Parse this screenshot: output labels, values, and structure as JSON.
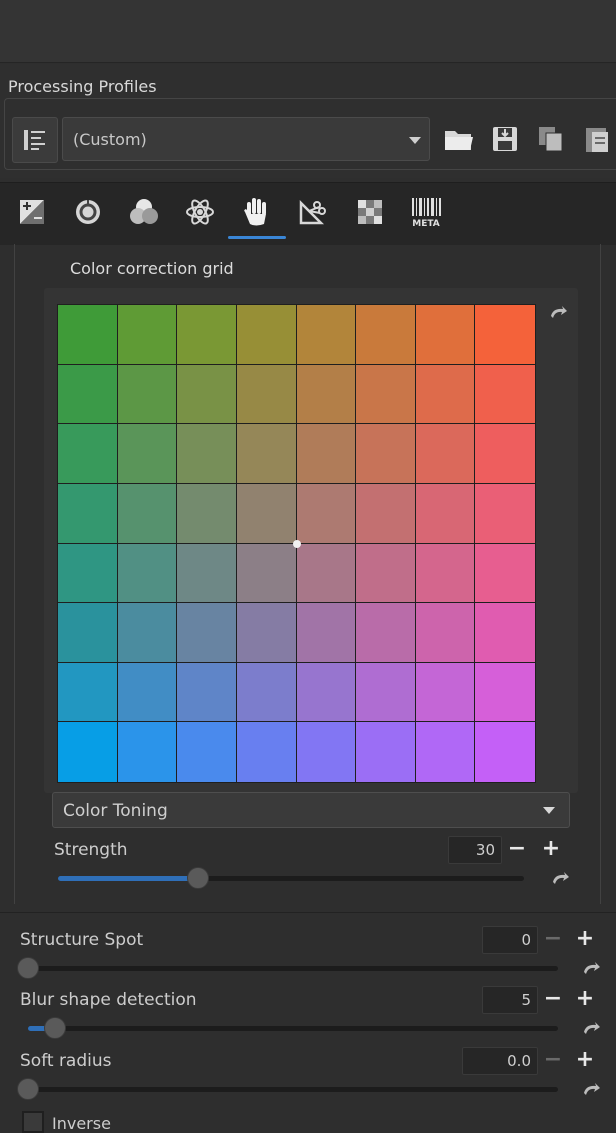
{
  "processing_profiles": {
    "title": "Processing Profiles",
    "selected_profile": "(Custom)"
  },
  "tabs": [
    {
      "icon": "exposure-icon"
    },
    {
      "icon": "detail-icon"
    },
    {
      "icon": "color-icon"
    },
    {
      "icon": "advanced-icon"
    },
    {
      "icon": "local-adjustments-icon",
      "active": true
    },
    {
      "icon": "transform-icon"
    },
    {
      "icon": "raw-icon"
    },
    {
      "icon": "metadata-icon",
      "label": "META"
    }
  ],
  "color_grid": {
    "title": "Color correction grid",
    "cells": [
      [
        "#3f9b38",
        "#5f9b35",
        "#7a9834",
        "#978f36",
        "#b2853a",
        "#c97a3b",
        "#e06f3b",
        "#f4623a"
      ],
      [
        "#3b9a48",
        "#5c9746",
        "#799246",
        "#978946",
        "#b37f48",
        "#c97649",
        "#de6b4b",
        "#f0604c"
      ],
      [
        "#389a5b",
        "#5a9559",
        "#778f59",
        "#958758",
        "#b07c59",
        "#c77359",
        "#db695b",
        "#ee5e5e"
      ],
      [
        "#34986f",
        "#56926e",
        "#748b6e",
        "#91826f",
        "#ad7a71",
        "#c37071",
        "#d86774",
        "#ea5f76"
      ],
      [
        "#2f9683",
        "#519084",
        "#6e8886",
        "#8c7f87",
        "#a87789",
        "#c06e8a",
        "#d4668d",
        "#e75e90"
      ],
      [
        "#2a929d",
        "#4b8c9f",
        "#6884a2",
        "#857ca4",
        "#a174a7",
        "#b96ca9",
        "#cd64ac",
        "#e05cb0"
      ],
      [
        "#2297c1",
        "#418dc5",
        "#5f85c8",
        "#7c7dcc",
        "#9775cf",
        "#af6dd2",
        "#c466d6",
        "#d65fd9"
      ],
      [
        "#079ee6",
        "#2b94ea",
        "#4a8aed",
        "#687ff0",
        "#8276f3",
        "#9b6ef5",
        "#b068f6",
        "#c460f7"
      ]
    ]
  },
  "color_toning": {
    "method": "Color Toning",
    "strength_label": "Strength",
    "strength_value": "30",
    "strength_fraction": 0.3
  },
  "structure_spot": {
    "label": "Structure Spot",
    "value": "0",
    "fraction": 0.0
  },
  "blur_shape_detection": {
    "label": "Blur shape detection",
    "value": "5",
    "fraction": 0.05
  },
  "soft_radius": {
    "label": "Soft radius",
    "value": "0.0",
    "fraction": 0.0
  },
  "inverse": {
    "label": "Inverse",
    "checked": false
  },
  "colors": {
    "accent": "#3a86d6",
    "slider_fill": "#2f6fb8"
  }
}
